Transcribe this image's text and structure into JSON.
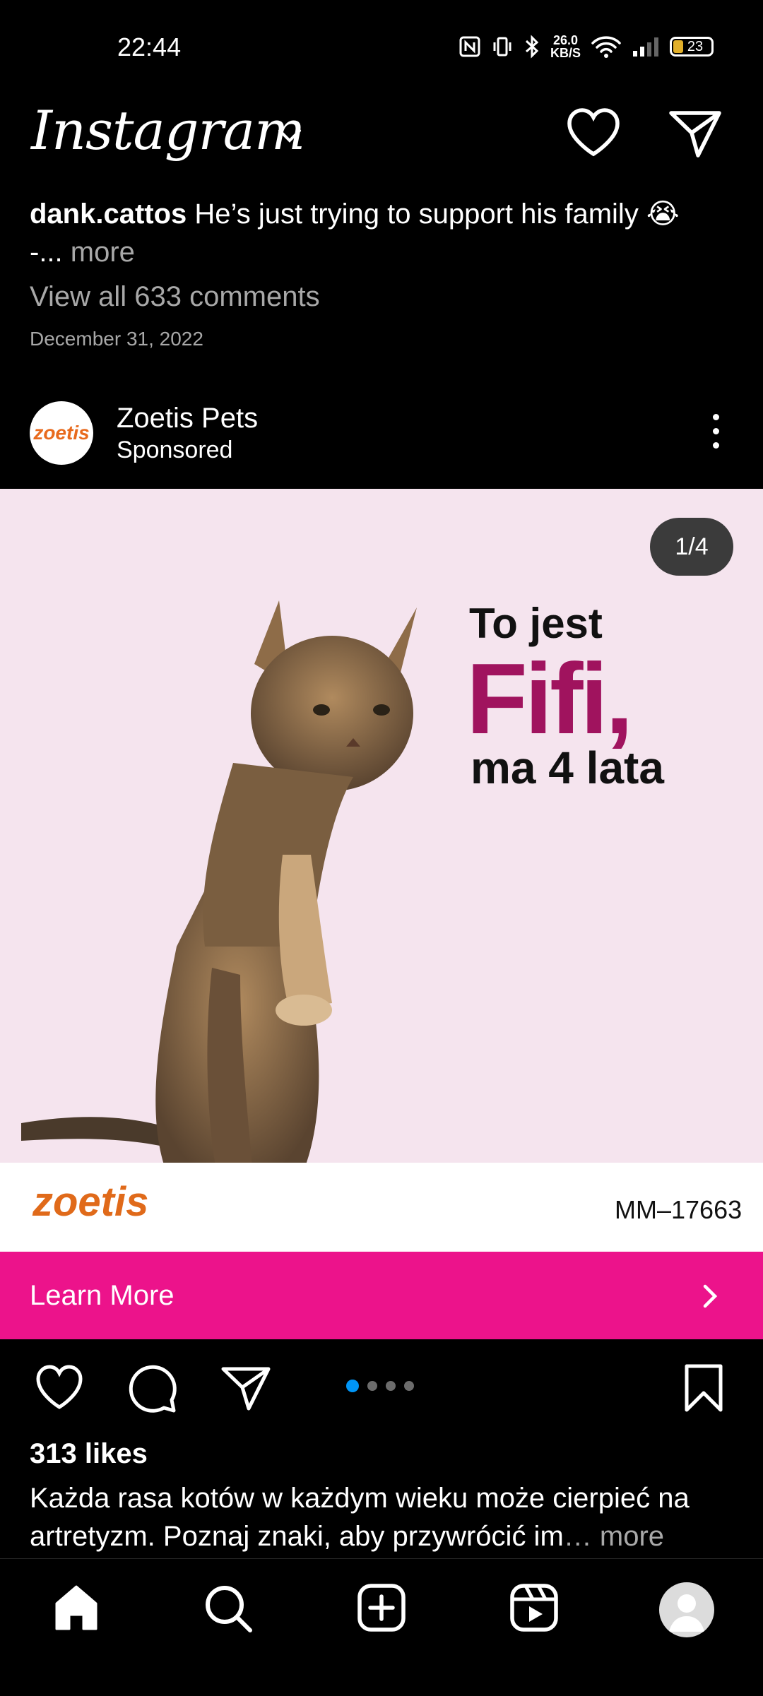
{
  "status_bar": {
    "time": "22:44",
    "net_speed_top": "26.0",
    "net_speed_unit": "KB/S",
    "battery": "23"
  },
  "header": {
    "app_name": "Instagram"
  },
  "prev_post": {
    "username": "dank.cattos",
    "caption": "He’s just trying to support his family 😭",
    "caption_cont": "-...",
    "more_label": "more",
    "view_comments": "View all 633 comments",
    "date": "December 31, 2022"
  },
  "ad": {
    "avatar_text": "zoetis",
    "account_name": "Zoetis Pets",
    "sponsored": "Sponsored",
    "counter": "1/4",
    "headline_1": "To jest",
    "headline_2": "Fifi,",
    "headline_3": "ma 4 lata",
    "brand": "zoetis",
    "code": "MM–17663",
    "cta": "Learn More",
    "likes": "313 likes",
    "caption": "Każda rasa kotów w każdym wieku może cierpieć na artretyzm. Poznaj znaki, aby przywrócić im",
    "caption_more": "… more",
    "carousel": {
      "count": 4,
      "active_index": 0
    }
  },
  "colors": {
    "accent": "#ec138b",
    "brand_purple": "#a0135e",
    "brand_orange": "#e06a1a",
    "media_bg": "#f5e4ee",
    "active_dot": "#0095f6"
  },
  "icons": [
    "heart-icon",
    "send-icon",
    "comment-icon",
    "bookmark-icon",
    "home-icon",
    "search-icon",
    "create-icon",
    "reels-icon"
  ]
}
